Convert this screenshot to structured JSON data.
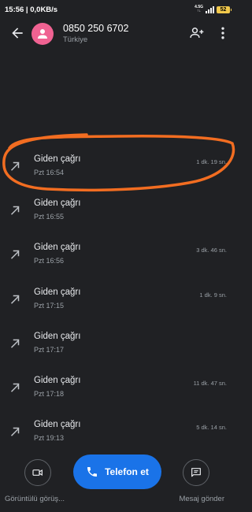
{
  "status_bar": {
    "time_speed": "15:56 | 0,0KB/s",
    "network": "4.5G",
    "battery": "52"
  },
  "header": {
    "number": "0850 250 6702",
    "country": "Türkiye"
  },
  "calls": [
    {
      "type": "Giden çağrı",
      "time": "Pzt 16:54",
      "duration": "1 dk. 19 sn."
    },
    {
      "type": "Giden çağrı",
      "time": "Pzt 16:55",
      "duration": ""
    },
    {
      "type": "Giden çağrı",
      "time": "Pzt 16:56",
      "duration": "3 dk. 46 sn."
    },
    {
      "type": "Giden çağrı",
      "time": "Pzt 17:15",
      "duration": "1 dk. 9 sn."
    },
    {
      "type": "Giden çağrı",
      "time": "Pzt 17:17",
      "duration": ""
    },
    {
      "type": "Giden çağrı",
      "time": "Pzt 17:18",
      "duration": "11 dk. 47 sn."
    },
    {
      "type": "Giden çağrı",
      "time": "Pzt 19:13",
      "duration": "5 dk. 14 sn."
    }
  ],
  "actions": {
    "call_label": "Telefon et",
    "video_label": "Görüntülü görüş...",
    "message_label": "Mesaj gönder"
  },
  "colors": {
    "background": "#202124",
    "accent": "#1a73e8",
    "avatar": "#f06292",
    "annotation": "#f26d21"
  }
}
